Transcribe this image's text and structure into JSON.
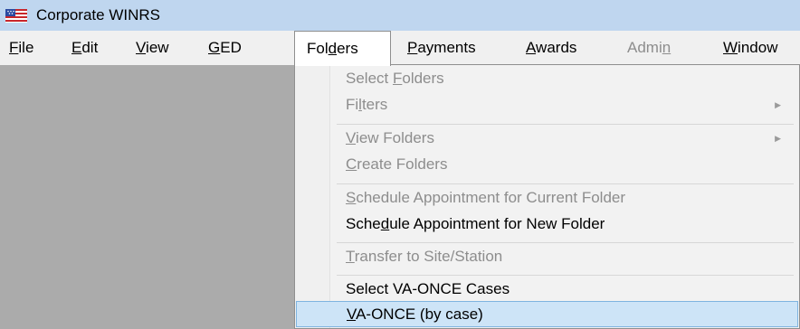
{
  "window": {
    "title": "Corporate WINRS"
  },
  "menubar": {
    "items": [
      {
        "label_pre": "",
        "label_ul": "F",
        "label_post": "ile"
      },
      {
        "label_pre": "",
        "label_ul": "E",
        "label_post": "dit"
      },
      {
        "label_pre": "",
        "label_ul": "V",
        "label_post": "iew"
      },
      {
        "label_pre": "",
        "label_ul": "G",
        "label_post": "ED"
      },
      {
        "label_pre": "Fol",
        "label_ul": "d",
        "label_post": "ers"
      },
      {
        "label_pre": "",
        "label_ul": "P",
        "label_post": "ayments"
      },
      {
        "label_pre": "",
        "label_ul": "A",
        "label_post": "wards"
      },
      {
        "label_pre": "Admi",
        "label_ul": "n",
        "label_post": ""
      },
      {
        "label_pre": "",
        "label_ul": "W",
        "label_post": "indow"
      }
    ]
  },
  "folders_menu": {
    "items": [
      {
        "pre": "Select ",
        "ul": "F",
        "post": "olders"
      },
      {
        "pre": "Fi",
        "ul": "l",
        "post": "ters",
        "arrow": "▶"
      },
      {
        "pre": "",
        "ul": "V",
        "post": "iew Folders",
        "arrow": "▶"
      },
      {
        "pre": "",
        "ul": "C",
        "post": "reate Folders"
      },
      {
        "pre": "",
        "ul": "S",
        "post": "chedule Appointment for Current Folder"
      },
      {
        "pre": "Sche",
        "ul": "d",
        "post": "ule Appointment for New Folder"
      },
      {
        "pre": "",
        "ul": "T",
        "post": "ransfer to Site/Station"
      },
      {
        "pre": "Select VA-ONCE Cases",
        "ul": "",
        "post": ""
      },
      {
        "pre": "",
        "ul": "V",
        "post": "A-ONCE (by case)"
      }
    ]
  }
}
